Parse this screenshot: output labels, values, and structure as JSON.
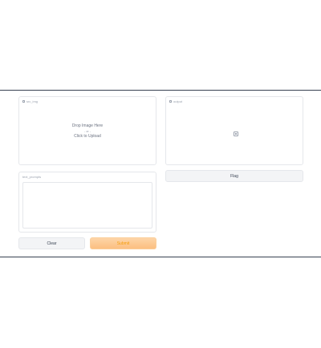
{
  "inputs": {
    "image_label": "src_img",
    "drop_text": "Drop Image Here",
    "or_text": "- or -",
    "click_text": "Click to Upload",
    "text_label": "text_prompts"
  },
  "output": {
    "label": "output"
  },
  "buttons": {
    "clear": "Clear",
    "submit": "Submit",
    "flag": "Flag"
  },
  "colors": {
    "accent": "#fcbf80",
    "border": "#e5e7eb",
    "muted": "#9ca3af"
  }
}
